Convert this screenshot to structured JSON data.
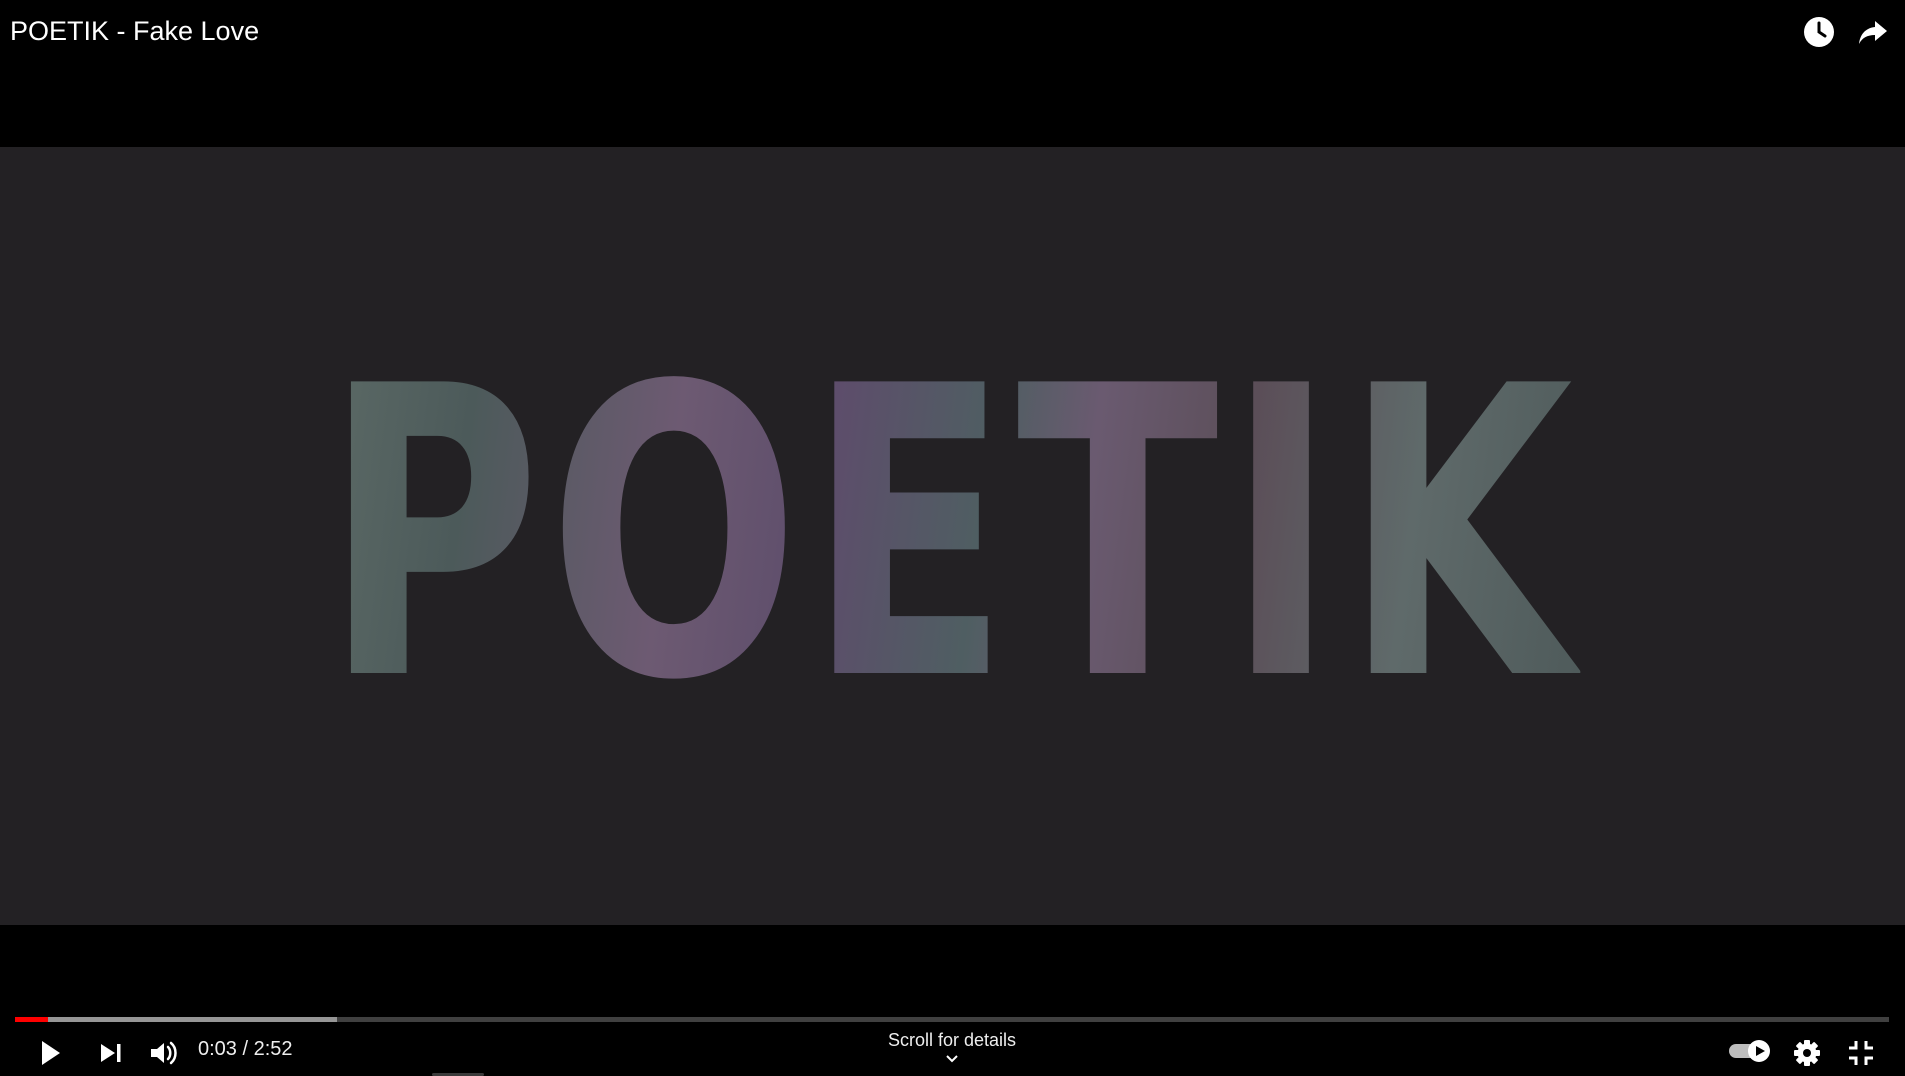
{
  "video": {
    "title": "POETIK - Fake Love",
    "frame_text": "POETIK"
  },
  "top_bar": {
    "watch_later_icon": "clock-icon",
    "share_icon": "share-arrow-icon"
  },
  "player": {
    "current_time": "0:03",
    "duration": "2:52",
    "time_text": "0:03 / 2:52",
    "played_fraction": 0.0174,
    "buffered_fraction": 0.172,
    "scroll_hint": "Scroll for details",
    "autoplay_on": true,
    "colors": {
      "progress_played": "#ff0000",
      "progress_buffered": "#9e9e9e",
      "background": "#000000",
      "video_bg": "#232124"
    },
    "icons": {
      "play": "play-icon",
      "next": "next-icon",
      "volume": "volume-icon",
      "autoplay": "autoplay-toggle-icon",
      "settings": "gear-icon",
      "exit_fullscreen": "exit-fullscreen-icon",
      "chevron": "chevron-down-icon"
    }
  }
}
